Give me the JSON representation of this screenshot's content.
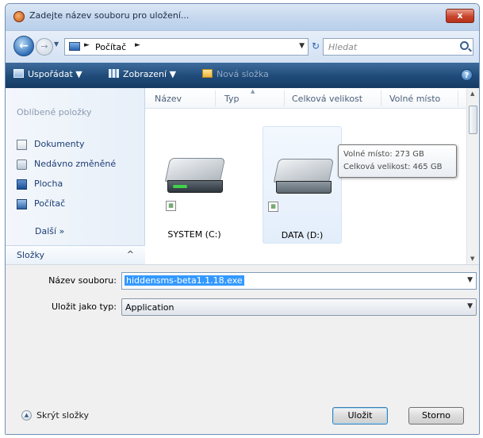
{
  "window": {
    "title": "Zadejte název souboru pro uložení...",
    "close_label": "x"
  },
  "navbar": {
    "breadcrumb": [
      "Počítač"
    ],
    "search_placeholder": "Hledat"
  },
  "toolbar": {
    "organize_label": "Uspořádat",
    "views_label": "Zobrazení",
    "new_folder_label": "Nová složka",
    "help_label": "?"
  },
  "navpane": {
    "favorites_header": "Oblíbené položky",
    "items": [
      {
        "label": "Dokumenty",
        "icon": "documents-icon"
      },
      {
        "label": "Nedávno změněné",
        "icon": "recent-icon"
      },
      {
        "label": "Plocha",
        "icon": "desktop-icon"
      },
      {
        "label": "Počítač",
        "icon": "computer-icon"
      }
    ],
    "more_label": "Další »",
    "folders_label": "Složky"
  },
  "filepane": {
    "columns": [
      "Název",
      "Typ",
      "Celková velikost",
      "Volné místo"
    ],
    "drives": [
      {
        "name": "SYSTEM (C:)",
        "icon": "hard-drive-icon",
        "selected": false
      },
      {
        "name": "DATA (D:)",
        "icon": "hard-drive-icon",
        "selected": true
      }
    ],
    "tooltip": {
      "free_space": "Volné místo: 273 GB",
      "total_size": "Celková velikost: 465 GB"
    }
  },
  "form": {
    "filename_label": "Název souboru:",
    "filename_value": "hiddensms-beta1.1.18.exe",
    "filetype_label": "Uložit jako typ:",
    "filetype_value": "Application"
  },
  "footer": {
    "hide_folders_label": "Skrýt složky",
    "save_label": "Uložit",
    "cancel_label": "Storno"
  },
  "colors": {
    "toolbar": "#1f4a78",
    "selection": "#3399ff",
    "close_button": "#c8442c"
  }
}
